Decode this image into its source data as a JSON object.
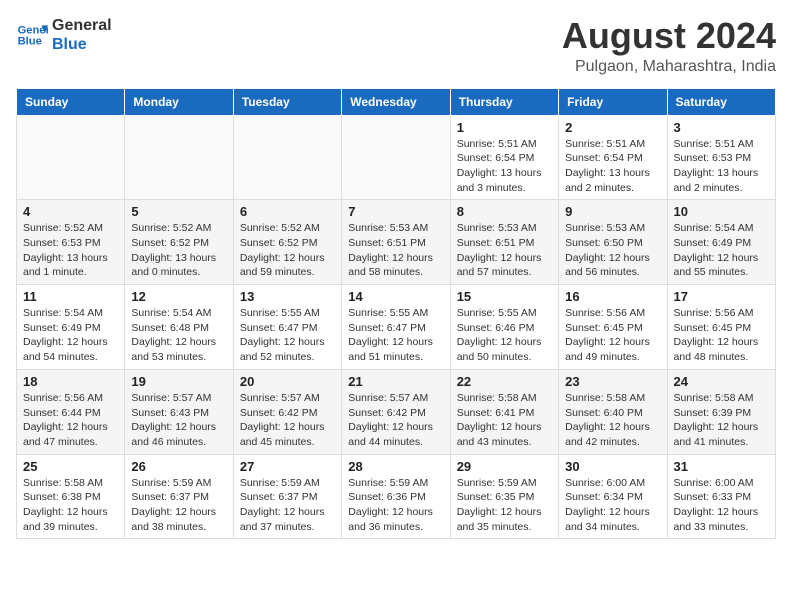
{
  "header": {
    "logo_line1": "General",
    "logo_line2": "Blue",
    "month_year": "August 2024",
    "location": "Pulgaon, Maharashtra, India"
  },
  "weekdays": [
    "Sunday",
    "Monday",
    "Tuesday",
    "Wednesday",
    "Thursday",
    "Friday",
    "Saturday"
  ],
  "weeks": [
    [
      {
        "day": "",
        "info": ""
      },
      {
        "day": "",
        "info": ""
      },
      {
        "day": "",
        "info": ""
      },
      {
        "day": "",
        "info": ""
      },
      {
        "day": "1",
        "info": "Sunrise: 5:51 AM\nSunset: 6:54 PM\nDaylight: 13 hours\nand 3 minutes."
      },
      {
        "day": "2",
        "info": "Sunrise: 5:51 AM\nSunset: 6:54 PM\nDaylight: 13 hours\nand 2 minutes."
      },
      {
        "day": "3",
        "info": "Sunrise: 5:51 AM\nSunset: 6:53 PM\nDaylight: 13 hours\nand 2 minutes."
      }
    ],
    [
      {
        "day": "4",
        "info": "Sunrise: 5:52 AM\nSunset: 6:53 PM\nDaylight: 13 hours\nand 1 minute."
      },
      {
        "day": "5",
        "info": "Sunrise: 5:52 AM\nSunset: 6:52 PM\nDaylight: 13 hours\nand 0 minutes."
      },
      {
        "day": "6",
        "info": "Sunrise: 5:52 AM\nSunset: 6:52 PM\nDaylight: 12 hours\nand 59 minutes."
      },
      {
        "day": "7",
        "info": "Sunrise: 5:53 AM\nSunset: 6:51 PM\nDaylight: 12 hours\nand 58 minutes."
      },
      {
        "day": "8",
        "info": "Sunrise: 5:53 AM\nSunset: 6:51 PM\nDaylight: 12 hours\nand 57 minutes."
      },
      {
        "day": "9",
        "info": "Sunrise: 5:53 AM\nSunset: 6:50 PM\nDaylight: 12 hours\nand 56 minutes."
      },
      {
        "day": "10",
        "info": "Sunrise: 5:54 AM\nSunset: 6:49 PM\nDaylight: 12 hours\nand 55 minutes."
      }
    ],
    [
      {
        "day": "11",
        "info": "Sunrise: 5:54 AM\nSunset: 6:49 PM\nDaylight: 12 hours\nand 54 minutes."
      },
      {
        "day": "12",
        "info": "Sunrise: 5:54 AM\nSunset: 6:48 PM\nDaylight: 12 hours\nand 53 minutes."
      },
      {
        "day": "13",
        "info": "Sunrise: 5:55 AM\nSunset: 6:47 PM\nDaylight: 12 hours\nand 52 minutes."
      },
      {
        "day": "14",
        "info": "Sunrise: 5:55 AM\nSunset: 6:47 PM\nDaylight: 12 hours\nand 51 minutes."
      },
      {
        "day": "15",
        "info": "Sunrise: 5:55 AM\nSunset: 6:46 PM\nDaylight: 12 hours\nand 50 minutes."
      },
      {
        "day": "16",
        "info": "Sunrise: 5:56 AM\nSunset: 6:45 PM\nDaylight: 12 hours\nand 49 minutes."
      },
      {
        "day": "17",
        "info": "Sunrise: 5:56 AM\nSunset: 6:45 PM\nDaylight: 12 hours\nand 48 minutes."
      }
    ],
    [
      {
        "day": "18",
        "info": "Sunrise: 5:56 AM\nSunset: 6:44 PM\nDaylight: 12 hours\nand 47 minutes."
      },
      {
        "day": "19",
        "info": "Sunrise: 5:57 AM\nSunset: 6:43 PM\nDaylight: 12 hours\nand 46 minutes."
      },
      {
        "day": "20",
        "info": "Sunrise: 5:57 AM\nSunset: 6:42 PM\nDaylight: 12 hours\nand 45 minutes."
      },
      {
        "day": "21",
        "info": "Sunrise: 5:57 AM\nSunset: 6:42 PM\nDaylight: 12 hours\nand 44 minutes."
      },
      {
        "day": "22",
        "info": "Sunrise: 5:58 AM\nSunset: 6:41 PM\nDaylight: 12 hours\nand 43 minutes."
      },
      {
        "day": "23",
        "info": "Sunrise: 5:58 AM\nSunset: 6:40 PM\nDaylight: 12 hours\nand 42 minutes."
      },
      {
        "day": "24",
        "info": "Sunrise: 5:58 AM\nSunset: 6:39 PM\nDaylight: 12 hours\nand 41 minutes."
      }
    ],
    [
      {
        "day": "25",
        "info": "Sunrise: 5:58 AM\nSunset: 6:38 PM\nDaylight: 12 hours\nand 39 minutes."
      },
      {
        "day": "26",
        "info": "Sunrise: 5:59 AM\nSunset: 6:37 PM\nDaylight: 12 hours\nand 38 minutes."
      },
      {
        "day": "27",
        "info": "Sunrise: 5:59 AM\nSunset: 6:37 PM\nDaylight: 12 hours\nand 37 minutes."
      },
      {
        "day": "28",
        "info": "Sunrise: 5:59 AM\nSunset: 6:36 PM\nDaylight: 12 hours\nand 36 minutes."
      },
      {
        "day": "29",
        "info": "Sunrise: 5:59 AM\nSunset: 6:35 PM\nDaylight: 12 hours\nand 35 minutes."
      },
      {
        "day": "30",
        "info": "Sunrise: 6:00 AM\nSunset: 6:34 PM\nDaylight: 12 hours\nand 34 minutes."
      },
      {
        "day": "31",
        "info": "Sunrise: 6:00 AM\nSunset: 6:33 PM\nDaylight: 12 hours\nand 33 minutes."
      }
    ]
  ]
}
